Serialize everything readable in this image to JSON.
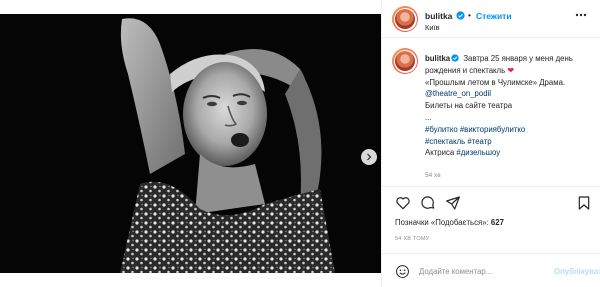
{
  "header": {
    "username": "bulitka",
    "separator": "•",
    "follow_label": "Стежити",
    "location": "Київ"
  },
  "caption": {
    "username": "bulitka",
    "text_1": "Завтра 25 января у меня день рождения и спектакль",
    "heart": "❤",
    "text_2": "«Прошлым летом в Чулимске» Драма.",
    "mention": "@theatre_on_podil",
    "text_3": "Билеты на сайте театра",
    "ellipsis": "...",
    "hashtags_line1": [
      "#булитко",
      "#викториябулитко"
    ],
    "hashtags_line2": [
      "#спектакль",
      "#театр"
    ],
    "actress_label": "Актриса",
    "hashtag_actress": "#дизельшоу",
    "time": "54 хв"
  },
  "likes": {
    "label": "Позначки «Подобається»:",
    "count": "627"
  },
  "post_time": "54 ХВ ТОМУ",
  "comment": {
    "placeholder": "Додайте коментар...",
    "publish_label": "Опублікувати"
  },
  "icons": {
    "verified": "verified-badge-icon",
    "more": "more-horizontal-icon",
    "like": "heart-icon",
    "comment": "comment-icon",
    "share": "paper-plane-icon",
    "save": "bookmark-icon",
    "emoji": "smiley-icon",
    "next": "chevron-right-icon"
  },
  "colors": {
    "accent": "#0095f6",
    "link": "#00376b",
    "heart": "#e0245e",
    "muted": "#8e8e8e",
    "publish_disabled": "#b2dffc"
  }
}
